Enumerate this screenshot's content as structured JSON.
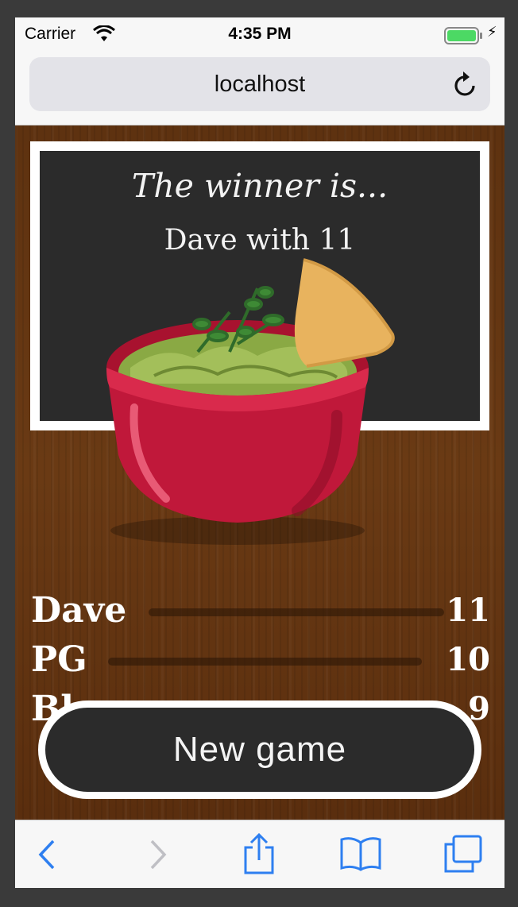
{
  "status_bar": {
    "carrier": "Carrier",
    "time": "4:35 PM"
  },
  "browser": {
    "url": "localhost"
  },
  "game": {
    "winner_label": "The winner is...",
    "winner_value": "Dave with 11",
    "players": [
      {
        "name": "Dave",
        "score": "11"
      },
      {
        "name": "PG",
        "score": "10"
      },
      {
        "name": "Bl",
        "score": "9"
      }
    ],
    "new_game_label": "New game"
  },
  "toolbar": {
    "icons": [
      "back-icon",
      "forward-icon",
      "share-icon",
      "bookmarks-icon",
      "tabs-icon"
    ]
  },
  "colors": {
    "accent": "#2e7ff0",
    "board": "#2b2b2b",
    "bowl": "#c0183a",
    "guac": "#8aa944",
    "chip": "#e8b35e"
  }
}
